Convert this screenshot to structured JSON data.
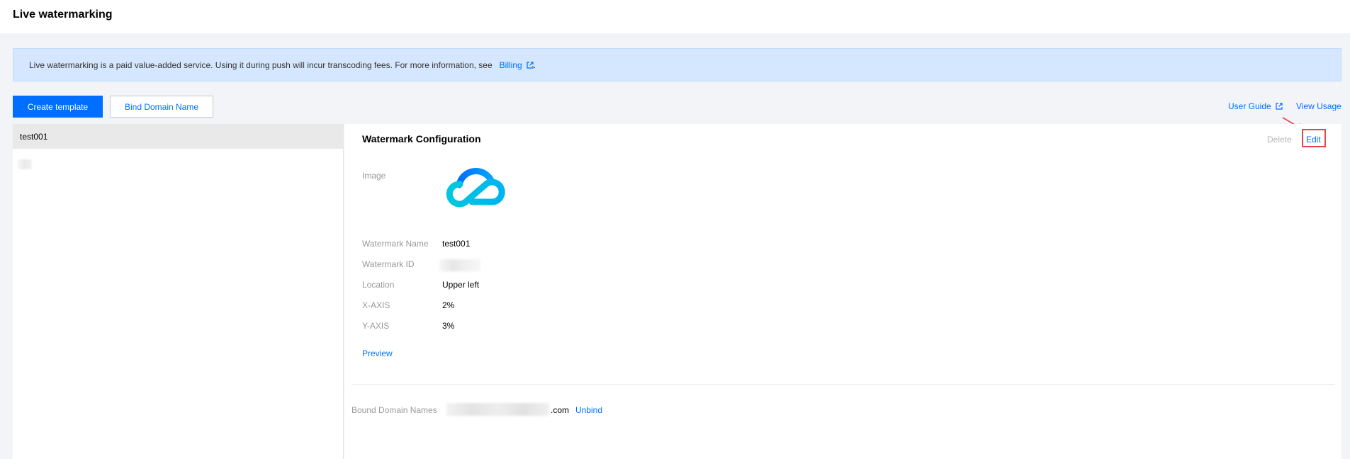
{
  "header": {
    "title": "Live watermarking"
  },
  "notice": {
    "text": "Live watermarking is a paid value-added service. Using it during push will incur transcoding fees. For more information, see",
    "link_label": "Billing",
    "suffix": "."
  },
  "toolbar": {
    "create_label": "Create template",
    "bind_label": "Bind Domain Name",
    "user_guide_label": "User Guide",
    "view_usage_label": "View Usage"
  },
  "template_list": {
    "items": [
      {
        "label": "test001",
        "selected": true
      }
    ]
  },
  "config": {
    "title": "Watermark Configuration",
    "delete_label": "Delete",
    "edit_label": "Edit",
    "image_label": "Image",
    "fields": [
      {
        "label": "Watermark Name",
        "value": "test001"
      },
      {
        "label": "Watermark ID",
        "value": ""
      },
      {
        "label": "Location",
        "value": "Upper left"
      },
      {
        "label": "X-AXIS",
        "value": "2%"
      },
      {
        "label": "Y-AXIS",
        "value": "3%"
      }
    ],
    "preview_label": "Preview"
  },
  "bound_domains": {
    "label": "Bound Domain Names",
    "domain_suffix": ".com",
    "unbind_label": "Unbind"
  },
  "colors": {
    "accent": "#006eff",
    "notice_bg": "#d5e7ff",
    "highlight": "#e54545"
  },
  "icons": {
    "external": "external-link-icon",
    "logo": "cloud-logo"
  }
}
